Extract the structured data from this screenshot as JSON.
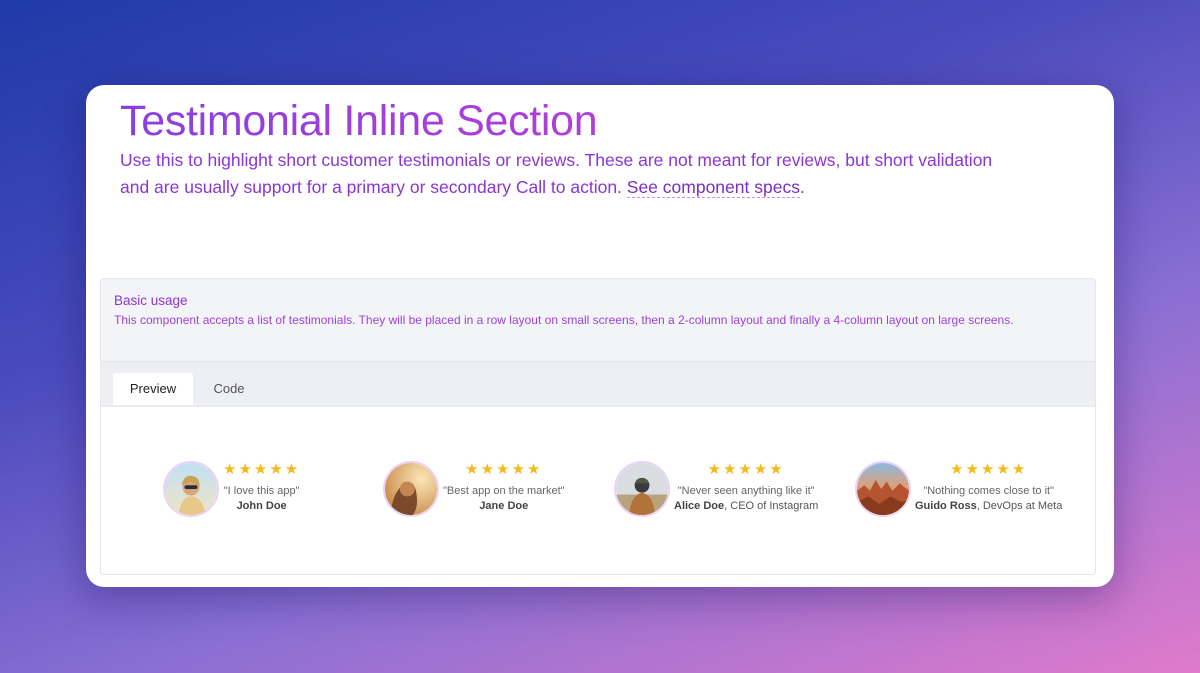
{
  "header": {
    "title": "Testimonial Inline Section",
    "intro": "Use this to highlight short customer testimonials or reviews. These are not meant for reviews, but short validation and are usually support for a primary or secondary Call to action. ",
    "link": "See component specs",
    "link_suffix": "."
  },
  "example": {
    "title": "Basic usage",
    "description": "This component accepts a list of testimonials. They will be placed in a row layout on small screens, then a 2-column layout and finally a 4-column layout on large screens.",
    "tabs": {
      "preview": "Preview",
      "code": "Code"
    }
  },
  "testimonials": [
    {
      "stars": "★★★★★",
      "rating": 5,
      "quote": "\"I love this app\"",
      "name": "John Doe",
      "role": ""
    },
    {
      "stars": "★★★★★",
      "rating": 5,
      "quote": "\"Best app on the market\"",
      "name": "Jane Doe",
      "role": ""
    },
    {
      "stars": "★★★★★",
      "rating": 5,
      "quote": "\"Never seen anything like it\"",
      "name": "Alice Doe",
      "role": ", CEO of Instagram"
    },
    {
      "stars": "★★★★★",
      "rating": 5,
      "quote": "\"Nothing comes close to it\"",
      "name": "Guido Ross",
      "role": ", DevOps at Meta"
    }
  ],
  "colors": {
    "accent": "#8b35d6",
    "star": "#f6b81a"
  },
  "icons": {
    "rating": "star-icon",
    "avatar": "avatar-photo"
  }
}
